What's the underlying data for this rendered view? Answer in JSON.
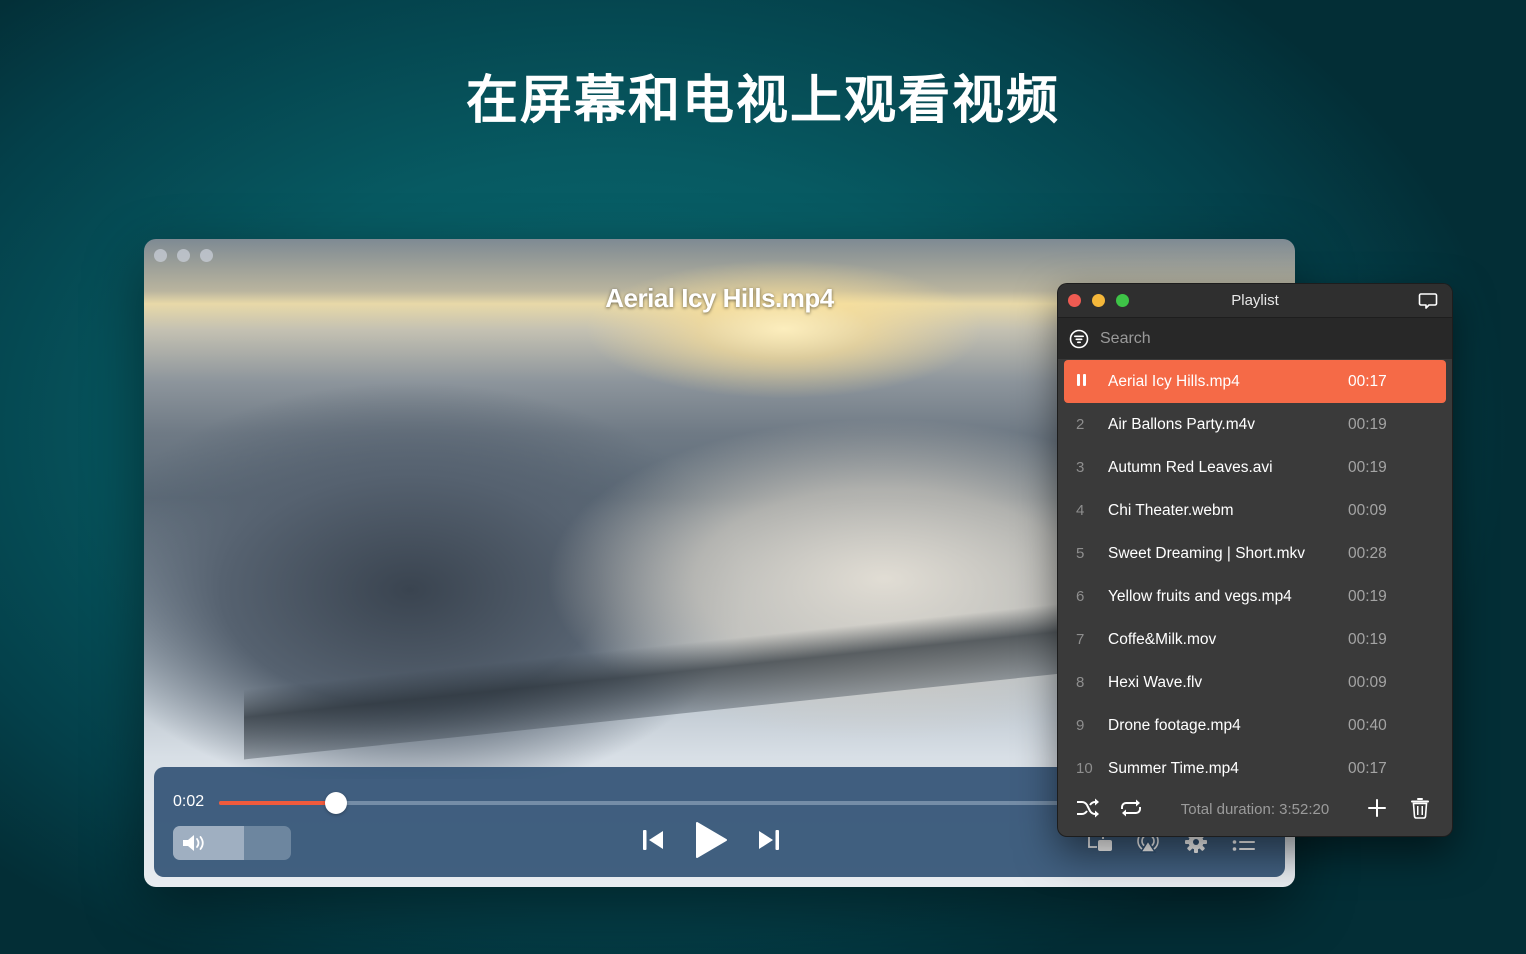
{
  "headline": "在屏幕和电视上观看视频",
  "player": {
    "video_title": "Aerial Icy Hills.mp4",
    "current_time": "0:02",
    "progress_fraction": 0.11,
    "volume_fraction": 0.6,
    "icons": {
      "volume": "speaker-icon",
      "previous": "skip-back-icon",
      "play": "play-icon",
      "next": "skip-forward-icon",
      "picture_in_picture": "pip-icon",
      "airplay": "airplay-icon",
      "settings": "gear-icon",
      "playlist": "list-icon"
    }
  },
  "playlist": {
    "title": "Playlist",
    "search_placeholder": "Search",
    "search_value": "",
    "items": [
      {
        "index": "",
        "name": "Aerial Icy Hills.mp4",
        "duration": "00:17",
        "active": true
      },
      {
        "index": "2",
        "name": "Air Ballons Party.m4v",
        "duration": "00:19"
      },
      {
        "index": "3",
        "name": "Autumn Red Leaves.avi",
        "duration": "00:19"
      },
      {
        "index": "4",
        "name": "Chi Theater.webm",
        "duration": "00:09"
      },
      {
        "index": "5",
        "name": "Sweet Dreaming | Short.mkv",
        "duration": "00:28"
      },
      {
        "index": "6",
        "name": "Yellow fruits and vegs.mp4",
        "duration": "00:19"
      },
      {
        "index": "7",
        "name": "Coffe&Milk.mov",
        "duration": "00:19"
      },
      {
        "index": "8",
        "name": "Hexi Wave.flv",
        "duration": "00:09"
      },
      {
        "index": "9",
        "name": "Drone footage.mp4",
        "duration": "00:40"
      },
      {
        "index": "10",
        "name": "Summer Time.mp4",
        "duration": "00:17"
      }
    ],
    "total_duration": "Total duration: 3:52:20",
    "colors": {
      "accent": "#f56a47",
      "close": "#ee5b52",
      "minimize": "#f4b73a",
      "maximize": "#3ec447"
    }
  }
}
